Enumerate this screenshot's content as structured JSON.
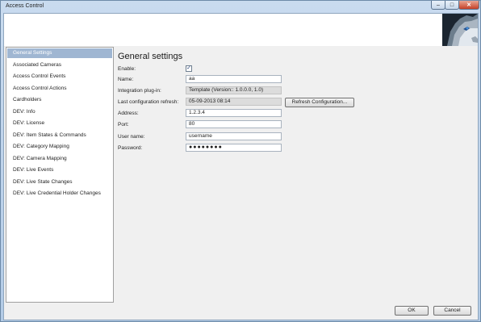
{
  "window": {
    "title": "Access Control"
  },
  "title_controls": {
    "minimize": "‒",
    "maximize": "□",
    "close": "✕"
  },
  "sidebar": {
    "items": [
      {
        "label": "General Settings",
        "active": true
      },
      {
        "label": "Associated Cameras"
      },
      {
        "label": "Access Control Events"
      },
      {
        "label": "Access Control Actions"
      },
      {
        "label": "Cardholders"
      },
      {
        "label": "DEV: Info"
      },
      {
        "label": "DEV: License"
      },
      {
        "label": "DEV: Item States & Commands"
      },
      {
        "label": "DEV: Category Mapping"
      },
      {
        "label": "DEV: Camera Mapping"
      },
      {
        "label": "DEV: Live Events"
      },
      {
        "label": "DEV: Live State Changes"
      },
      {
        "label": "DEV: Live Credential Holder Changes"
      }
    ]
  },
  "main": {
    "heading": "General settings",
    "form": {
      "enable_label": "Enable:",
      "enable_checked": true,
      "enable_mark": "✓",
      "name_label": "Name:",
      "name_value": "aa",
      "plugin_label": "Integration plug-in:",
      "plugin_value": "Template (Version:: 1.0.0.0, 1.0)",
      "refresh_label": "Last configuration refresh:",
      "refresh_value": "05-09-2013 08:14",
      "refresh_button": "Refresh Configuration...",
      "address_label": "Address:",
      "address_value": "1.2.3.4",
      "port_label": "Port:",
      "port_value": "80",
      "username_label": "User name:",
      "username_value": "username",
      "password_label": "Password:",
      "password_value": "●●●●●●●●"
    }
  },
  "footer": {
    "ok_label": "OK",
    "cancel_label": "Cancel"
  },
  "colors": {
    "selection": "#9fb6d2",
    "window_frame": "#b3cbe6",
    "close_button": "#c64127"
  }
}
